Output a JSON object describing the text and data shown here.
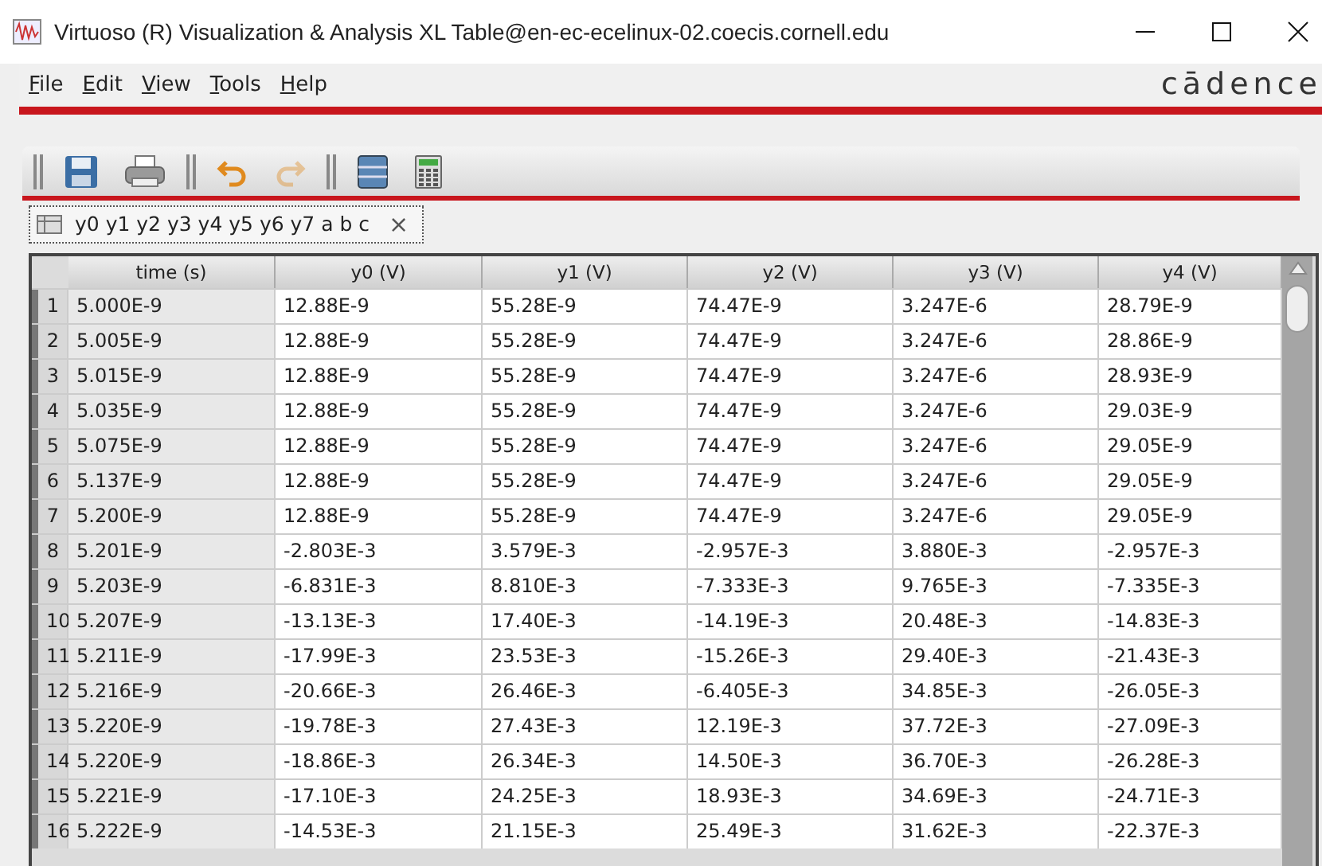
{
  "window": {
    "title": "Virtuoso (R) Visualization & Analysis XL Table@en-ec-ecelinux-02.coecis.cornell.edu"
  },
  "menu": [
    "File",
    "Edit",
    "View",
    "Tools",
    "Help"
  ],
  "logo": "cādence",
  "toolbar": [
    {
      "kind": "save",
      "disabled": false
    },
    {
      "kind": "print",
      "disabled": false
    },
    {
      "kind": "grip"
    },
    {
      "kind": "undo",
      "disabled": false
    },
    {
      "kind": "redo",
      "disabled": true
    },
    {
      "kind": "grip"
    },
    {
      "kind": "columns",
      "disabled": false
    },
    {
      "kind": "calculator",
      "disabled": false
    }
  ],
  "tabs": [
    {
      "label": "y0 y1 y2 y3 y4 y5 y6 y7 a b c",
      "close": "×",
      "selected": true
    }
  ],
  "table": {
    "columns": [
      "time (s)",
      "y0 (V)",
      "y1 (V)",
      "y2 (V)",
      "y3 (V)",
      "y4 (V)"
    ],
    "rows": [
      [
        "1",
        "5.000E-9",
        "12.88E-9",
        "55.28E-9",
        "74.47E-9",
        "3.247E-6",
        "28.79E-9"
      ],
      [
        "2",
        "5.005E-9",
        "12.88E-9",
        "55.28E-9",
        "74.47E-9",
        "3.247E-6",
        "28.86E-9"
      ],
      [
        "3",
        "5.015E-9",
        "12.88E-9",
        "55.28E-9",
        "74.47E-9",
        "3.247E-6",
        "28.93E-9"
      ],
      [
        "4",
        "5.035E-9",
        "12.88E-9",
        "55.28E-9",
        "74.47E-9",
        "3.247E-6",
        "29.03E-9"
      ],
      [
        "5",
        "5.075E-9",
        "12.88E-9",
        "55.28E-9",
        "74.47E-9",
        "3.247E-6",
        "29.05E-9"
      ],
      [
        "6",
        "5.137E-9",
        "12.88E-9",
        "55.28E-9",
        "74.47E-9",
        "3.247E-6",
        "29.05E-9"
      ],
      [
        "7",
        "5.200E-9",
        "12.88E-9",
        "55.28E-9",
        "74.47E-9",
        "3.247E-6",
        "29.05E-9"
      ],
      [
        "8",
        "5.201E-9",
        "-2.803E-3",
        "3.579E-3",
        "-2.957E-3",
        "3.880E-3",
        "-2.957E-3"
      ],
      [
        "9",
        "5.203E-9",
        "-6.831E-3",
        "8.810E-3",
        "-7.333E-3",
        "9.765E-3",
        "-7.335E-3"
      ],
      [
        "10",
        "5.207E-9",
        "-13.13E-3",
        "17.40E-3",
        "-14.19E-3",
        "20.48E-3",
        "-14.83E-3"
      ],
      [
        "11",
        "5.211E-9",
        "-17.99E-3",
        "23.53E-3",
        "-15.26E-3",
        "29.40E-3",
        "-21.43E-3"
      ],
      [
        "12",
        "5.216E-9",
        "-20.66E-3",
        "26.46E-3",
        "-6.405E-3",
        "34.85E-3",
        "-26.05E-3"
      ],
      [
        "13",
        "5.220E-9",
        "-19.78E-3",
        "27.43E-3",
        "12.19E-3",
        "37.72E-3",
        "-27.09E-3"
      ],
      [
        "14",
        "5.220E-9",
        "-18.86E-3",
        "26.34E-3",
        "14.50E-3",
        "36.70E-3",
        "-26.28E-3"
      ],
      [
        "15",
        "5.221E-9",
        "-17.10E-3",
        "24.25E-3",
        "18.93E-3",
        "34.69E-3",
        "-24.71E-3"
      ],
      [
        "16",
        "5.222E-9",
        "-14.53E-3",
        "21.15E-3",
        "25.49E-3",
        "31.62E-3",
        "-22.37E-3"
      ]
    ]
  }
}
